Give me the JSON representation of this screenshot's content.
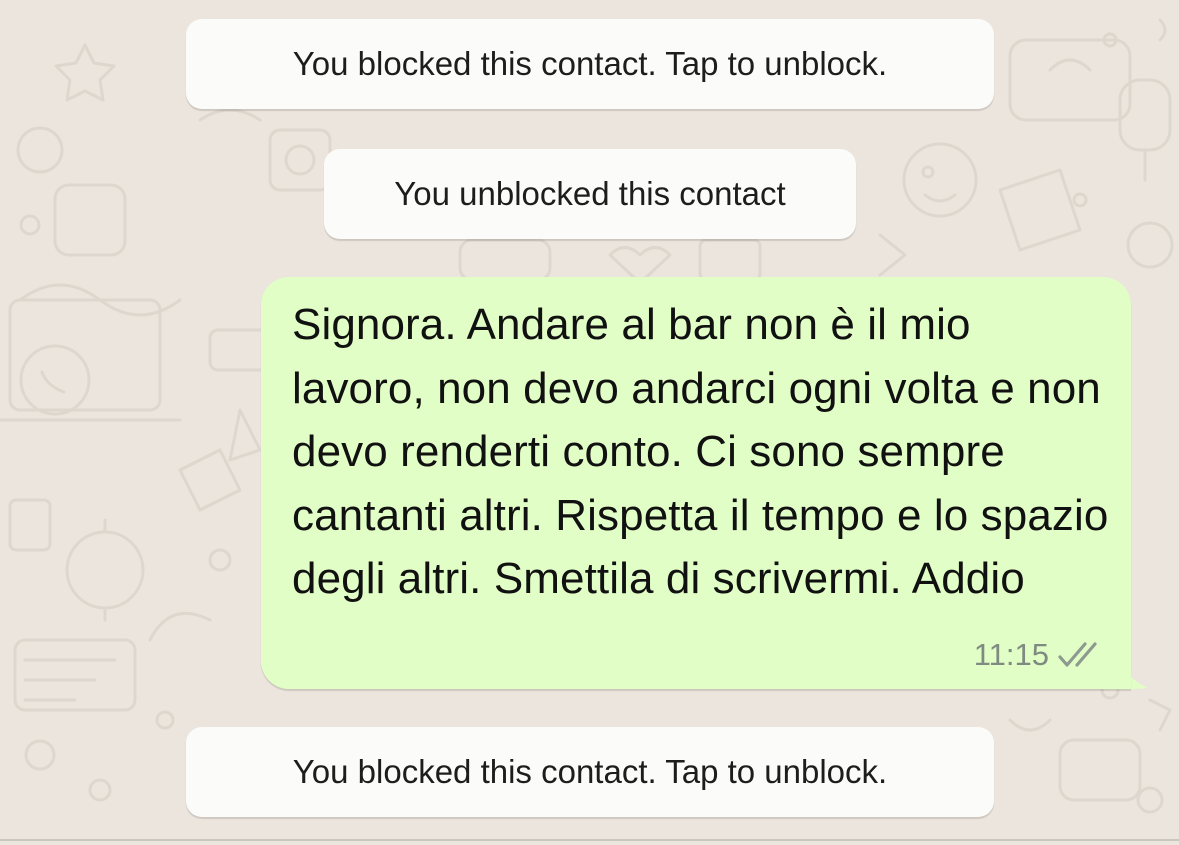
{
  "chat": {
    "background_color": "#ece5dd",
    "system_messages": [
      {
        "text": "You blocked this contact. Tap to unblock."
      },
      {
        "text": "You unblocked this contact"
      },
      {
        "text": "You blocked this contact. Tap to unblock."
      }
    ],
    "outgoing_message": {
      "text": "Signora. Andare al bar non è il mio lavoro, non devo andarci ogni volta e non devo renderti conto. Ci sono sempre cantanti altri. Rispetta il tempo e lo spazio degli altri. Smettila di scrivermi. Addio",
      "time": "11:15",
      "status_icon": "double-check-icon",
      "bubble_color": "#e1fec6"
    }
  }
}
